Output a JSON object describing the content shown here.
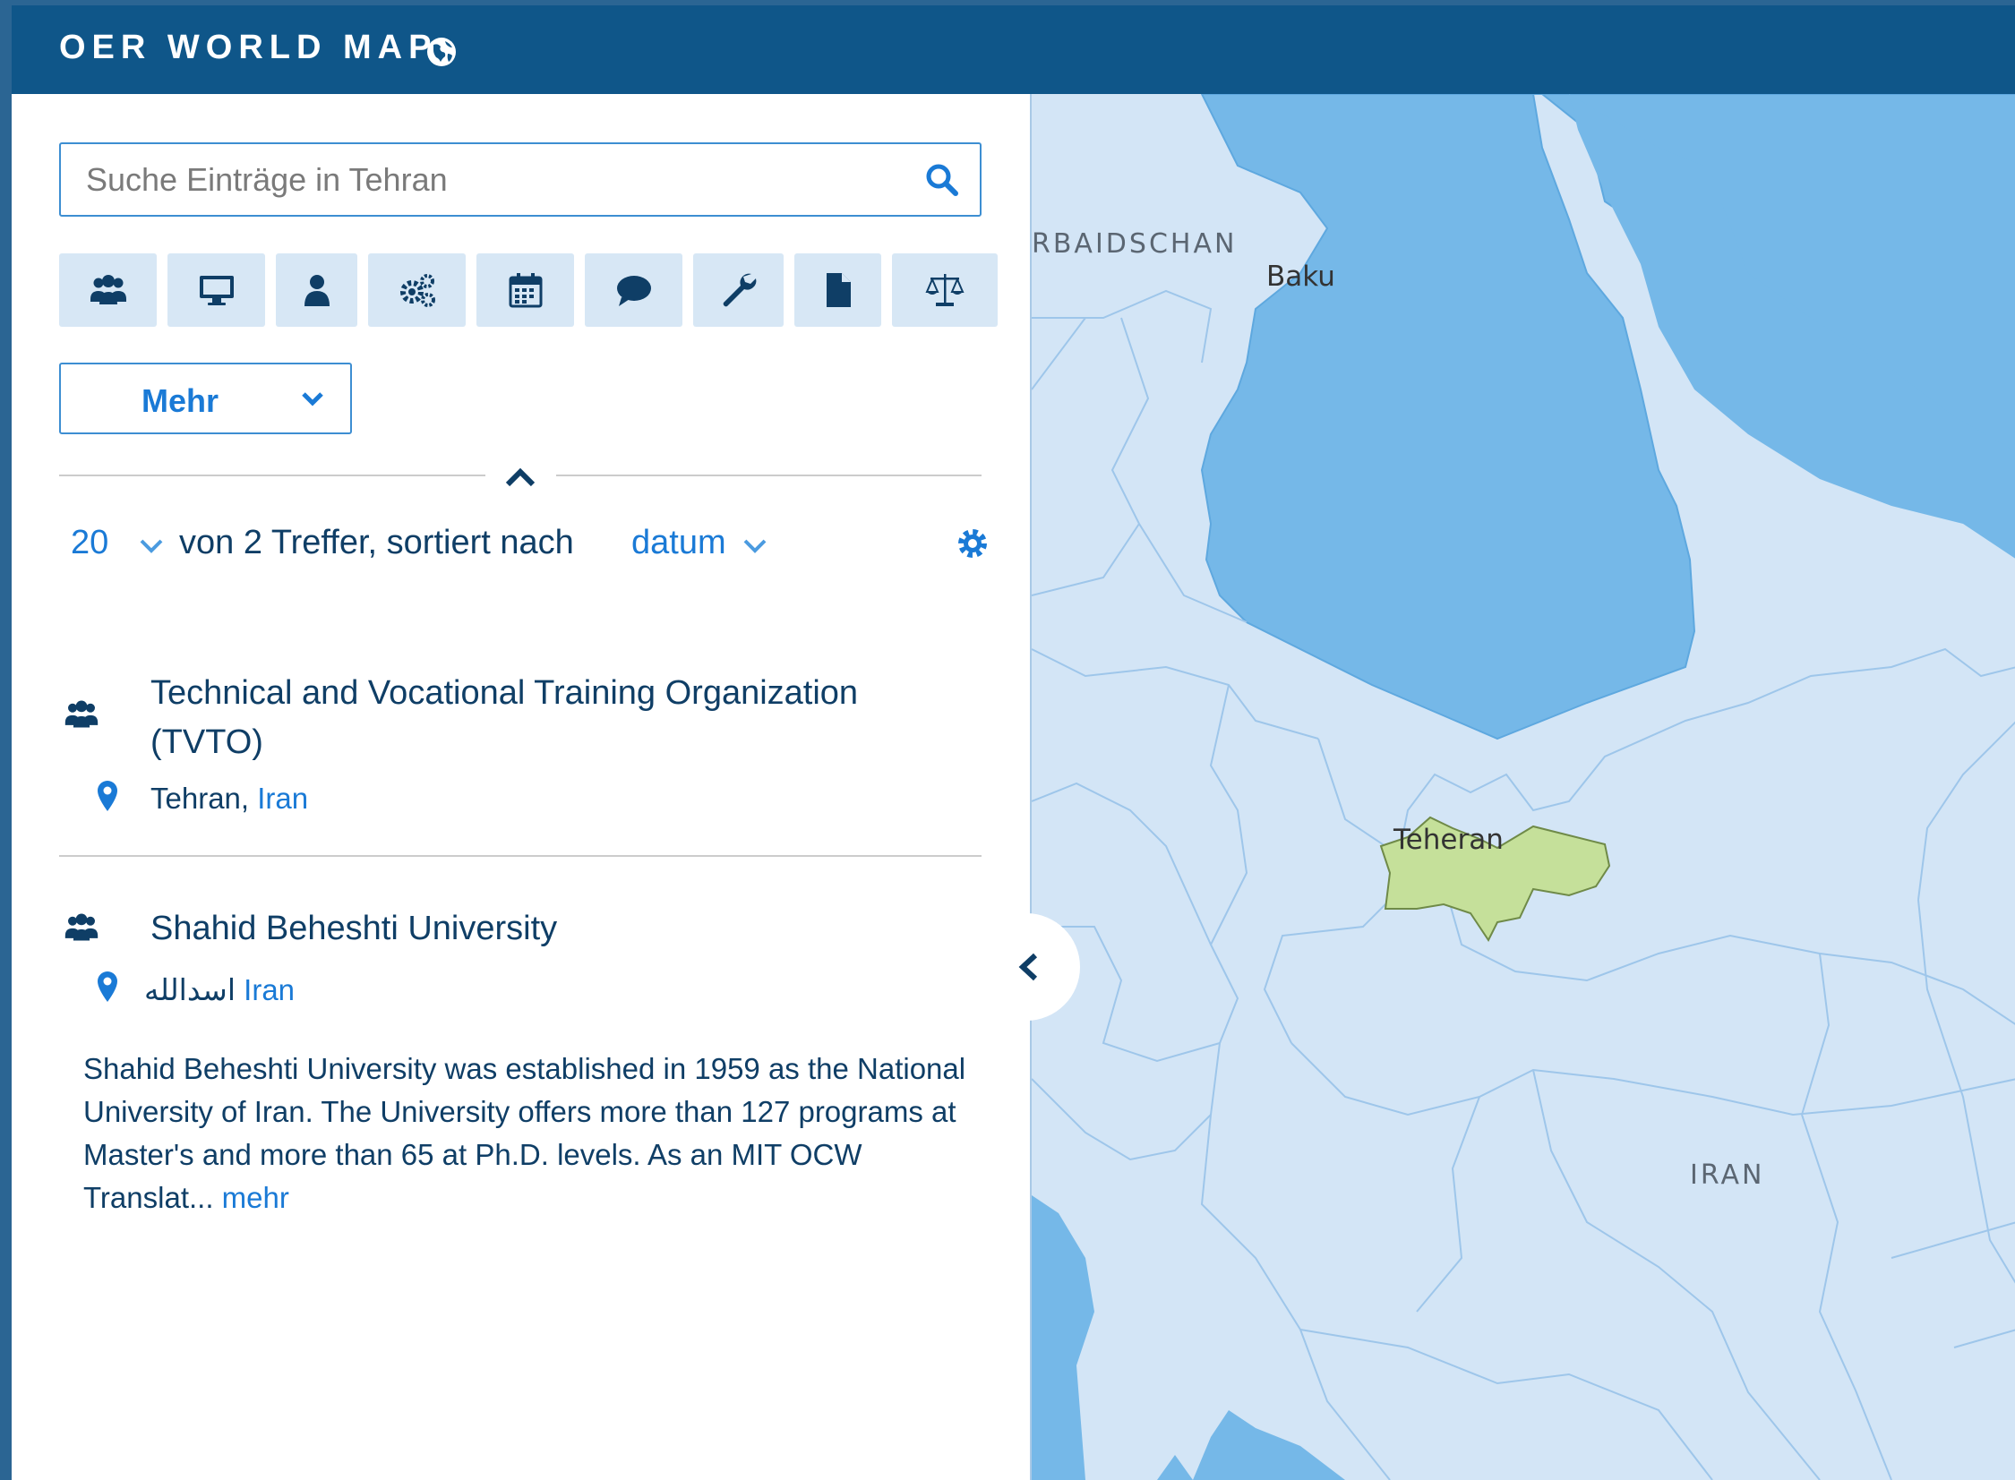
{
  "header": {
    "brand": "OER WORLD MAP",
    "brand_icon": "globe-icon"
  },
  "search": {
    "placeholder": "Suche Einträge in Tehran",
    "value": "",
    "button_icon": "search-icon"
  },
  "type_filters": [
    {
      "icon": "users-icon"
    },
    {
      "icon": "desktop-icon"
    },
    {
      "icon": "user-icon"
    },
    {
      "icon": "gears-icon"
    },
    {
      "icon": "calendar-icon"
    },
    {
      "icon": "comment-icon"
    },
    {
      "icon": "wrench-icon"
    },
    {
      "icon": "file-icon"
    },
    {
      "icon": "balance-scale-icon"
    }
  ],
  "more_filters": {
    "label": "Mehr"
  },
  "results": {
    "per_page": "20",
    "text": "von 2 Treffer, sortiert nach",
    "sort_by": "datum"
  },
  "entries": [
    {
      "type_icon": "users-icon",
      "title_line1": "Technical and Vocational Training Organization",
      "title_line2": "(TVTO)",
      "locality": "Tehran,",
      "country": "Iran"
    },
    {
      "type_icon": "users-icon",
      "title": "Shahid Beheshti University",
      "locality": "اسدالله",
      "country": "Iran",
      "description": "Shahid Beheshti University was established in 1959 as the National University of Iran. The University offers more than 127 programs at Master's and more than 65 at Ph.D. levels. As an MIT OCW Translat...",
      "more_link": "mehr"
    }
  ],
  "map": {
    "labels": {
      "region": "RBAIDSCHAN",
      "city_baku": "Baku",
      "city_tehran": "Teheran",
      "country": "IRAN"
    },
    "colors": {
      "land": "#d3e5f6",
      "sea": "#75b8e8",
      "highlight": "#c5e09a"
    }
  },
  "colors": {
    "header": "#0f5689",
    "accent": "#1a7ad6",
    "text": "#0f3e66",
    "button_bg": "#d7e7f5"
  }
}
